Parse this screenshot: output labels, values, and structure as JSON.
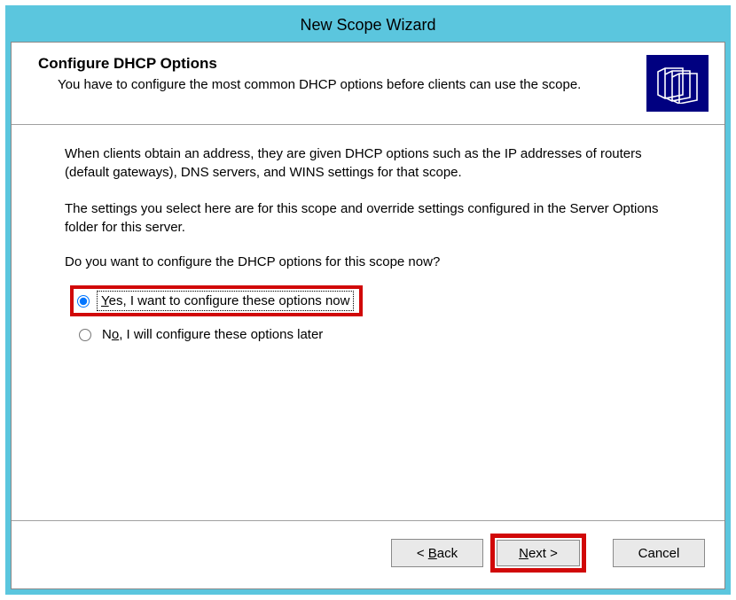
{
  "window": {
    "title": "New Scope Wizard"
  },
  "header": {
    "title": "Configure DHCP Options",
    "subtitle": "You have to configure the most common DHCP options before clients can use the scope."
  },
  "body": {
    "para1": "When clients obtain an address, they are given DHCP options such as the IP addresses of routers (default gateways), DNS servers, and WINS settings for that scope.",
    "para2": "The settings you select here are for this scope and override settings configured in the Server Options folder for this server.",
    "prompt": "Do you want to configure the DHCP options for this scope now?",
    "radio_yes_pre": "Y",
    "radio_yes_rest": "es, I want to configure these options now",
    "radio_no_pre": "N",
    "radio_no_mnemonic": "o",
    "radio_no_rest": ", I will configure these options later",
    "selected": "yes"
  },
  "buttons": {
    "back_lt": "< ",
    "back_mnemonic": "B",
    "back_rest": "ack",
    "next_mnemonic": "N",
    "next_rest": "ext >",
    "cancel": "Cancel"
  }
}
